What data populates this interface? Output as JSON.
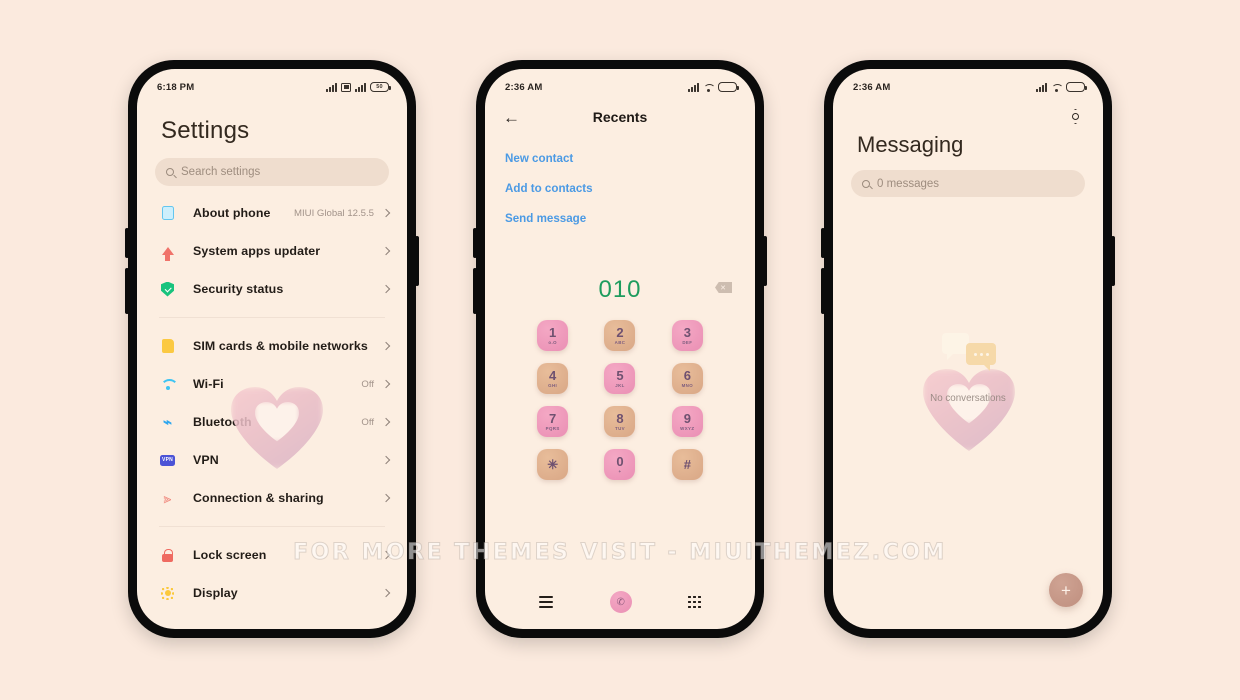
{
  "watermark": "FOR MORE THEMES VISIT - MIUITHEMEZ.COM",
  "theme": {
    "page_bg": "#fbeade",
    "screen_bg": "#fceee1",
    "accent_green": "#1e9c5e",
    "accent_blue": "#4b9ae4",
    "key_pink": "#ea8fb4",
    "key_tan": "#d9a786"
  },
  "phone1": {
    "status": {
      "time": "6:18 PM",
      "signal1": "signal-icon",
      "sim": "sim-card-icon",
      "signal2": "signal-icon",
      "battery": "50"
    },
    "title": "Settings",
    "search": {
      "placeholder": "Search settings",
      "icon": "search-icon"
    },
    "groups": [
      {
        "items": [
          {
            "label": "About phone",
            "value": "MIUI Global 12.5.5",
            "icon": "phone-icon"
          },
          {
            "label": "System apps updater",
            "value": "",
            "icon": "update-arrow-icon"
          },
          {
            "label": "Security status",
            "value": "",
            "icon": "shield-check-icon"
          }
        ]
      },
      {
        "items": [
          {
            "label": "SIM cards & mobile networks",
            "value": "",
            "icon": "sim-card-icon"
          },
          {
            "label": "Wi-Fi",
            "value": "Off",
            "icon": "wifi-icon"
          },
          {
            "label": "Bluetooth",
            "value": "Off",
            "icon": "bluetooth-icon"
          },
          {
            "label": "VPN",
            "value": "",
            "icon": "vpn-icon"
          },
          {
            "label": "Connection & sharing",
            "value": "",
            "icon": "connection-sharing-icon"
          }
        ]
      },
      {
        "items": [
          {
            "label": "Lock screen",
            "value": "",
            "icon": "lock-icon"
          },
          {
            "label": "Display",
            "value": "",
            "icon": "sun-icon"
          }
        ]
      }
    ]
  },
  "phone2": {
    "status": {
      "time": "2:36 AM",
      "signal": "signal-icon",
      "wifi": "wifi-icon",
      "battery": ""
    },
    "back": "←",
    "title": "Recents",
    "links": [
      "New contact",
      "Add to contacts",
      "Send message"
    ],
    "dialed_number": "010",
    "delete_icon": "backspace-icon",
    "keys": [
      {
        "num": "1",
        "letters": "o.O",
        "color": "pink"
      },
      {
        "num": "2",
        "letters": "ABC",
        "color": "tan"
      },
      {
        "num": "3",
        "letters": "DEF",
        "color": "pink"
      },
      {
        "num": "4",
        "letters": "GHI",
        "color": "tan"
      },
      {
        "num": "5",
        "letters": "JKL",
        "color": "pink"
      },
      {
        "num": "6",
        "letters": "MNO",
        "color": "tan"
      },
      {
        "num": "7",
        "letters": "PQRS",
        "color": "pink"
      },
      {
        "num": "8",
        "letters": "TUV",
        "color": "tan"
      },
      {
        "num": "9",
        "letters": "WXYZ",
        "color": "pink"
      },
      {
        "num": "✳",
        "letters": "",
        "color": "tan"
      },
      {
        "num": "0",
        "letters": "+",
        "color": "pink"
      },
      {
        "num": "#",
        "letters": "",
        "color": "tan"
      }
    ],
    "nav": {
      "menu": "menu-icon",
      "call": "call-icon",
      "keypad": "keypad-icon",
      "call_glyph": "✆"
    }
  },
  "phone3": {
    "status": {
      "time": "2:36 AM",
      "signal": "signal-icon",
      "wifi": "wifi-icon",
      "battery": ""
    },
    "settings_icon": "gear-icon",
    "title": "Messaging",
    "search": {
      "placeholder": "0 messages",
      "icon": "search-icon"
    },
    "empty_state": {
      "label": "No conversations",
      "icon": "chat-bubbles-icon"
    },
    "fab": {
      "label": "+",
      "icon": "plus-icon"
    }
  }
}
